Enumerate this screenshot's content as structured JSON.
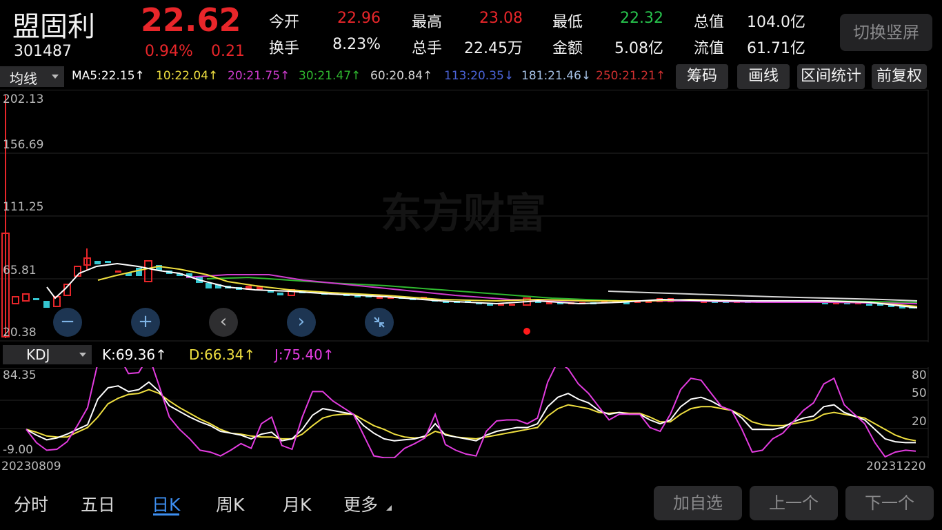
{
  "header": {
    "stock_name": "盟固利",
    "stock_code": "301487",
    "price": "22.62",
    "change_pct": "0.94%",
    "change_amt": "0.21",
    "stats": [
      {
        "label": "今开",
        "value": "22.96",
        "color": "#e8262a"
      },
      {
        "label": "最高",
        "value": "23.08",
        "color": "#e8262a"
      },
      {
        "label": "最低",
        "value": "22.32",
        "color": "#27c24c"
      },
      {
        "label": "总值",
        "value": "104.0亿",
        "color": "#f2f2f2"
      },
      {
        "label": "换手",
        "value": "8.23%",
        "color": "#f2f2f2"
      },
      {
        "label": "总手",
        "value": "22.45万",
        "color": "#f2f2f2"
      },
      {
        "label": "金额",
        "value": "5.08亿",
        "color": "#f2f2f2"
      },
      {
        "label": "流值",
        "value": "61.71亿",
        "color": "#f2f2f2"
      }
    ],
    "switch_button": "切换竖屏"
  },
  "toolbar": {
    "indicator_select": "均线",
    "ma": [
      {
        "text": "MA5:22.15↑",
        "color": "#ffffff"
      },
      {
        "text": "10:22.04↑",
        "color": "#f0e040"
      },
      {
        "text": "20:21.75↑",
        "color": "#d03cd0"
      },
      {
        "text": "30:21.47↑",
        "color": "#2fb82f"
      },
      {
        "text": "60:20.84↑",
        "color": "#d8d8d8"
      },
      {
        "text": "113:20.35↓",
        "color": "#4a63d8"
      },
      {
        "text": "181:21.46↓",
        "color": "#a7c3e8"
      },
      {
        "text": "250:21.21↑",
        "color": "#d23030"
      }
    ],
    "buttons": [
      "筹码",
      "画线",
      "区间统计",
      "前复权"
    ]
  },
  "main_chart": {
    "y_ticks": [
      "202.13",
      "156.69",
      "111.25",
      "65.81",
      "20.38"
    ],
    "watermark": "东方财富",
    "controls": [
      "zoom-out",
      "zoom-in",
      "prev",
      "next",
      "collapse"
    ]
  },
  "kdj": {
    "select": "KDJ",
    "k_label": "K:69.36↑",
    "d_label": "D:66.34↑",
    "j_label": "J:75.40↑",
    "y_left": [
      "84.35",
      "-9.00"
    ],
    "y_right": [
      "80",
      "50",
      "20"
    ],
    "date_start": "20230809",
    "date_end": "20231220"
  },
  "bottom": {
    "tabs": [
      "分时",
      "五日",
      "日K",
      "周K",
      "月K",
      "更多"
    ],
    "active_tab": "日K",
    "buttons": [
      "加自选",
      "上一个",
      "下一个"
    ]
  },
  "chart_data": [
    {
      "type": "line",
      "series": [
        {
          "name": "K",
          "values": [
            20,
            14,
            9,
            11,
            15,
            20,
            25,
            52,
            64,
            66,
            60,
            62,
            70,
            60,
            45,
            39,
            33,
            28,
            24,
            18,
            16,
            14,
            10,
            15,
            17,
            8,
            10,
            20,
            35,
            42,
            40,
            38,
            36,
            24,
            16,
            10,
            8,
            9,
            10,
            13,
            26,
            14,
            12,
            10,
            8,
            14,
            18,
            20,
            22,
            22,
            26,
            44,
            54,
            58,
            52,
            48,
            40,
            36,
            38,
            36,
            36,
            30,
            26,
            30,
            44,
            52,
            54,
            50,
            44,
            40,
            32,
            20,
            20,
            20,
            22,
            28,
            32,
            34,
            44,
            46,
            38,
            34,
            30,
            20,
            10,
            7,
            6,
            6
          ]
        },
        {
          "name": "D",
          "values": [
            20,
            17,
            13,
            12,
            12,
            17,
            22,
            33,
            47,
            53,
            57,
            58,
            62,
            58,
            50,
            43,
            37,
            31,
            26,
            20,
            16,
            15,
            13,
            12,
            12,
            10,
            10,
            15,
            24,
            32,
            35,
            36,
            36,
            30,
            24,
            20,
            15,
            12,
            11,
            12,
            18,
            15,
            12,
            11,
            10,
            12,
            14,
            16,
            18,
            20,
            22,
            34,
            42,
            46,
            44,
            42,
            38,
            37,
            38,
            37,
            37,
            33,
            28,
            28,
            36,
            42,
            44,
            44,
            42,
            40,
            35,
            28,
            25,
            24,
            24,
            26,
            28,
            30,
            36,
            38,
            36,
            34,
            32,
            26,
            20,
            14,
            10,
            8
          ]
        },
        {
          "name": "J",
          "values": [
            20,
            6,
            -2,
            -1,
            7,
            24,
            43,
            90,
            108,
            99,
            79,
            80,
            98,
            66,
            33,
            20,
            10,
            -2,
            -4,
            -8,
            -2,
            5,
            0,
            26,
            33,
            3,
            -1,
            33,
            60,
            60,
            50,
            43,
            36,
            14,
            -8,
            -10,
            -10,
            0,
            5,
            11,
            36,
            4,
            -2,
            -6,
            -8,
            18,
            29,
            30,
            30,
            26,
            32,
            70,
            92,
            84,
            68,
            58,
            44,
            30,
            36,
            36,
            36,
            22,
            18,
            36,
            62,
            74,
            72,
            58,
            44,
            40,
            20,
            -4,
            -2,
            10,
            16,
            28,
            40,
            48,
            68,
            74,
            46,
            36,
            26,
            6,
            -9,
            -4,
            -2,
            -3
          ]
        }
      ]
    }
  ]
}
